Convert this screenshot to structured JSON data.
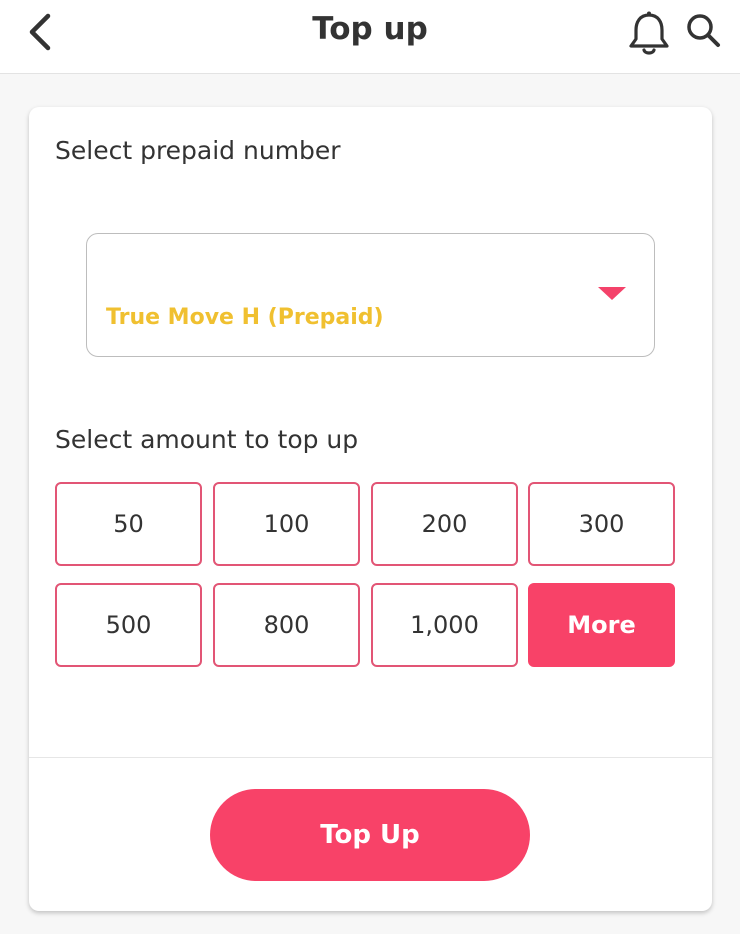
{
  "header": {
    "title": "Top up",
    "back_icon": "chevron-left-icon",
    "bell_icon": "bell-icon",
    "search_icon": "search-icon"
  },
  "prepaid": {
    "label": "Select prepaid number",
    "selected_carrier": "True Move H (Prepaid)",
    "dropdown_icon": "caret-down-icon"
  },
  "amount": {
    "label": "Select amount to top up",
    "options": [
      "50",
      "100",
      "200",
      "300",
      "500",
      "800",
      "1,000",
      "More"
    ]
  },
  "actions": {
    "topup_label": "Top Up"
  },
  "colors": {
    "accent": "#f84268",
    "carrier_text": "#f0c030",
    "outline": "#e25575"
  }
}
